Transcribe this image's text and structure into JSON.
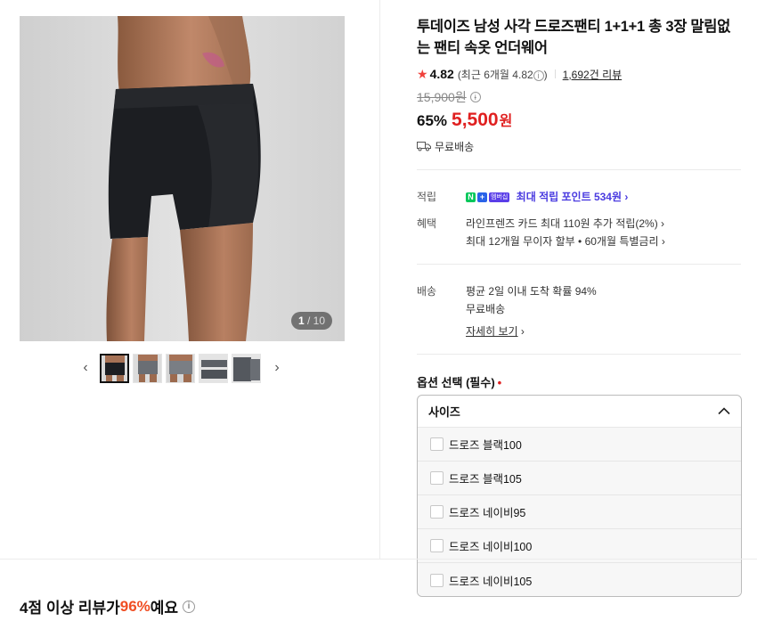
{
  "gallery": {
    "counter_current": "1",
    "counter_total": "/ 10",
    "prev_arrow": "‹",
    "next_arrow": "›"
  },
  "product": {
    "title": "투데이즈 남성 사각 드로즈팬티 1+1+1 총 3장 말림없는 팬티 속옷 언더웨어",
    "rating": "4.82",
    "recent_rating": "(최근 6개월 4.82",
    "recent_rating_close": ")",
    "review_count": "1,692건 리뷰",
    "original_price": "15,900원",
    "discount": "65%",
    "price": "5,500",
    "price_unit": "원",
    "shipping": "무료배송"
  },
  "specs": {
    "points_label": "적립",
    "npay_n": "N",
    "npay_plus": "+",
    "npay_tag": "멤버십",
    "points_value": "최대 적립 포인트 534원 ›",
    "benefit_label": "혜택",
    "benefit_line1": "라인프렌즈 카드 최대 110원 추가 적립(2%) ›",
    "benefit_line2": "최대 12개월 무이자 할부 • 60개월 특별금리 ›",
    "delivery_label": "배송",
    "delivery_line1": "평균 2일 이내 도착 확률 94%",
    "delivery_line2": "무료배송",
    "delivery_detail": "자세히 보기",
    "delivery_detail_arrow": "›"
  },
  "options": {
    "title": "옵션 선택 (필수)",
    "required_mark": "•",
    "dropdown_label": "사이즈",
    "items": [
      "드로즈 블랙100",
      "드로즈 블랙105",
      "드로즈 네이비95",
      "드로즈 네이비100",
      "드로즈 네이비105"
    ]
  },
  "reviews": {
    "headline_prefix": "4점 이상 리뷰가 ",
    "headline_pct": "96%",
    "headline_suffix": "예요"
  },
  "colors": {
    "price_red": "#e02020",
    "point_purple": "#4a3be0",
    "review_orange": "#f04e23"
  }
}
